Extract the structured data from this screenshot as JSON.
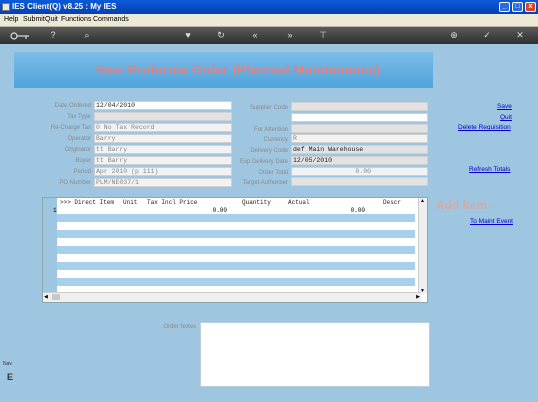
{
  "window": {
    "title": "IES Client(Q) v8.25 : My IES",
    "min": "_",
    "max": "□",
    "close": "x"
  },
  "menu": [
    "Help",
    "Submit",
    "Quit",
    "Functions",
    "Commands"
  ],
  "toolbar": {
    "help": "?",
    "search": "⌕",
    "heart": "♥",
    "refresh": "↻",
    "first": "«",
    "last": "»",
    "pin": "⊤",
    "globe": "⊕",
    "check": "✓",
    "close": "✕"
  },
  "page_title": "New Proforma Order (Planned Maintenance)",
  "form_left": [
    {
      "label": "Date Ordered",
      "value": "12/04/2010"
    },
    {
      "label": "Tax Type",
      "value": ""
    },
    {
      "label": "Re-Charge Tax",
      "value": "0 No Tax Record"
    },
    {
      "label": "Operator",
      "value": "Barry"
    },
    {
      "label": "Originator",
      "value": "tt Barry"
    },
    {
      "label": "Buyer",
      "value": "tt Barry"
    },
    {
      "label": "Period",
      "value": "Apr 2010 (p 111)"
    },
    {
      "label": "PO Number",
      "value": "PLM/NE037/1"
    }
  ],
  "form_right": [
    {
      "label": "Supplier Code",
      "value": ""
    },
    {
      "label": "",
      "value": ""
    },
    {
      "label": "For Attention",
      "value": ""
    },
    {
      "label": "Currency",
      "value": "R"
    },
    {
      "label": "Delivery Code",
      "value": "def Main Warehouse"
    },
    {
      "label": "Exp Delivery Date",
      "value": "12/05/2010"
    },
    {
      "label": "Order Total",
      "value": "0.00"
    },
    {
      "label": "Target Authoriser",
      "value": ""
    }
  ],
  "links": {
    "save": "Save",
    "quit": "Quit",
    "delete": "Delete Requisition",
    "refresh": "Refresh Totals",
    "maint": "To Maint Event"
  },
  "grid": {
    "headers": [
      ">>> Direct Item",
      "Unit",
      "Tax Incl Price",
      "Quantity",
      "Actual",
      "Descr"
    ],
    "row1": {
      "num": "1",
      "price": "0.00",
      "actual": "0.00"
    }
  },
  "add_item": "Add Item -",
  "notes_label": "Order Notes",
  "side_bits": {
    "a": "Nav",
    "b": "E"
  }
}
